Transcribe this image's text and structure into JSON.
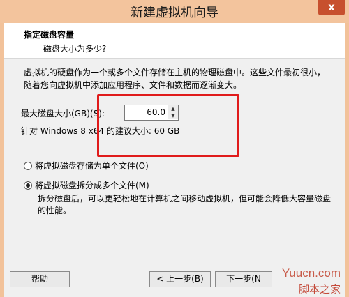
{
  "window": {
    "title": "新建虚拟机向导",
    "close_glyph": "x"
  },
  "header": {
    "title": "指定磁盘容量",
    "subtitle": "磁盘大小为多少?"
  },
  "description": "虚拟机的硬盘作为一个或多个文件存储在主机的物理磁盘中。这些文件最初很小，随着您向虚拟机中添加应用程序、文件和数据而逐渐变大。",
  "disk": {
    "max_size_label": "最大磁盘大小(GB)(S):",
    "max_size_value": "60.0",
    "recommended": "针对 Windows 8 x64 的建议大小: 60 GB"
  },
  "options": {
    "single_file": "将虚拟磁盘存储为单个文件(O)",
    "multi_file": "将虚拟磁盘拆分成多个文件(M)",
    "selected": "multi_file",
    "multi_file_note": "拆分磁盘后，可以更轻松地在计算机之间移动虚拟机，但可能会降低大容量磁盘的性能。"
  },
  "buttons": {
    "help": "帮助",
    "back": "< 上一步(B)",
    "next": "下一步(N"
  },
  "watermark": {
    "latin": "Yuucn.com",
    "han": "脚本之家"
  },
  "colors": {
    "highlight_red": "#e01b1b",
    "titlebar": "#f3c49d",
    "close_button": "#c7502e"
  }
}
